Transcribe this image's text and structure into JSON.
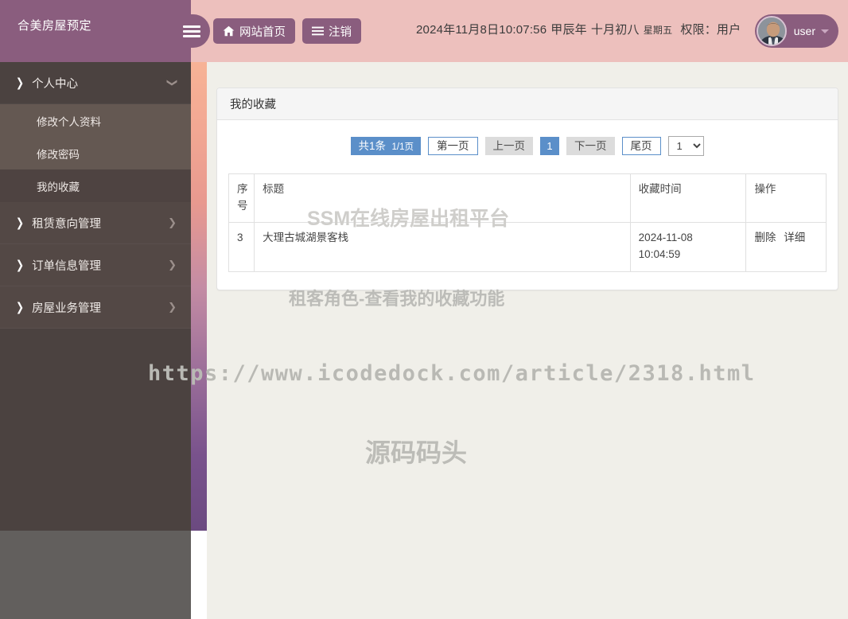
{
  "header": {
    "logo_title": "合美房屋预定",
    "menu_toggle_icon": "hamburger-icon",
    "home_button": {
      "label": "网站首页",
      "icon": "home-icon"
    },
    "logout_button": {
      "label": "注销",
      "icon": "list-icon"
    },
    "datetime": {
      "full": "2024年11月8日10:07:56",
      "ganzhi_year": "甲辰年",
      "lunar_date": "十月初八",
      "weekday": "星期五",
      "role_label": "权限：",
      "role_value": "用户"
    },
    "user": {
      "name": "user",
      "avatar": "user-avatar",
      "caret": "chevron-down-icon"
    }
  },
  "sidebar": {
    "groups": [
      {
        "label": "个人中心",
        "expanded": true,
        "items": [
          {
            "label": "修改个人资料",
            "active": false
          },
          {
            "label": "修改密码",
            "active": false
          },
          {
            "label": "我的收藏",
            "active": true
          }
        ]
      },
      {
        "label": "租赁意向管理",
        "expanded": false,
        "items": []
      },
      {
        "label": "订单信息管理",
        "expanded": false,
        "items": []
      },
      {
        "label": "房屋业务管理",
        "expanded": false,
        "items": []
      }
    ]
  },
  "card": {
    "title": "我的收藏"
  },
  "pagination": {
    "summary_total": "共1条",
    "summary_pages": "1/1页",
    "first_page": "第一页",
    "prev_page": "上一页",
    "current_page": "1",
    "next_page": "下一页",
    "last_page": "尾页",
    "page_select_value": "1",
    "page_select_options": [
      "1"
    ]
  },
  "table": {
    "columns": [
      "序号",
      "标题",
      "收藏时间",
      "操作"
    ],
    "rows": [
      {
        "index": "3",
        "title": "大理古城湖景客栈",
        "time_date": "2024-11-08",
        "time_clock": "10:04:59",
        "actions": [
          "删除",
          "详细"
        ]
      }
    ]
  },
  "watermarks": {
    "platform": "SSM在线房屋出租平台",
    "feature": "租客角色-查看我的收藏功能",
    "url": "https://www.icodedock.com/article/2318.html",
    "brand": "源码码头"
  },
  "colors": {
    "header_bg": "#edc0bd",
    "accent_purple": "#8a5d7e",
    "sidebar_bg": "#4b4240",
    "sidebar_sub_bg": "#645852",
    "content_bg": "#f0efe9",
    "pager_blue": "#5b8fc9",
    "pager_gray": "#dcdcdc"
  }
}
